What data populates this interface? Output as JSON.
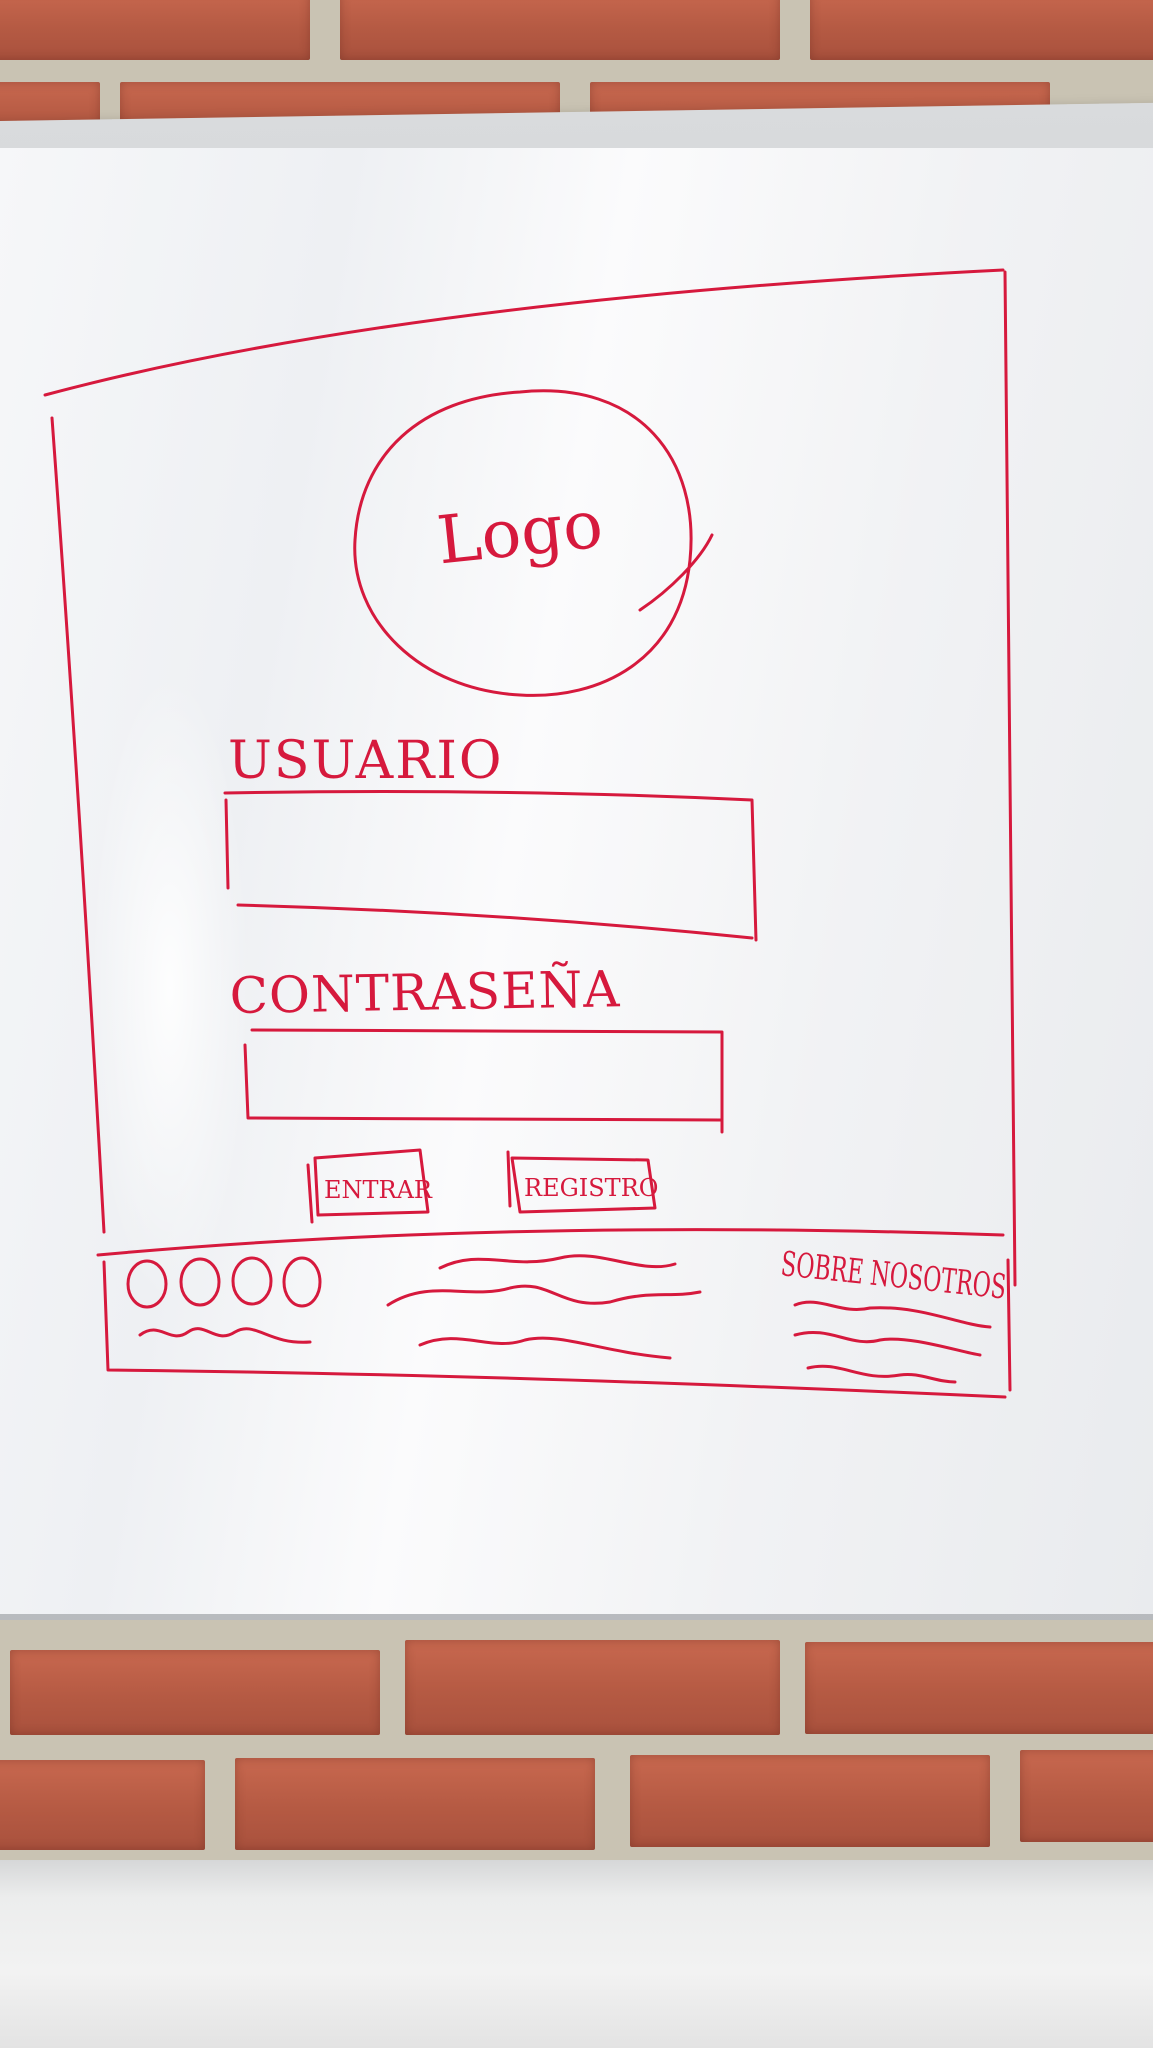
{
  "wireframe": {
    "logo_text": "Logo",
    "username_label": "USUARIO",
    "password_label": "CONTRASEÑA",
    "login_button": "ENTRAR",
    "register_button": "REGISTRO",
    "footer_about": "SOBRE NOSOTROS"
  },
  "colors": {
    "marker": "#d6193d",
    "board": "#f3f4f6",
    "brick": "#b9664f"
  }
}
